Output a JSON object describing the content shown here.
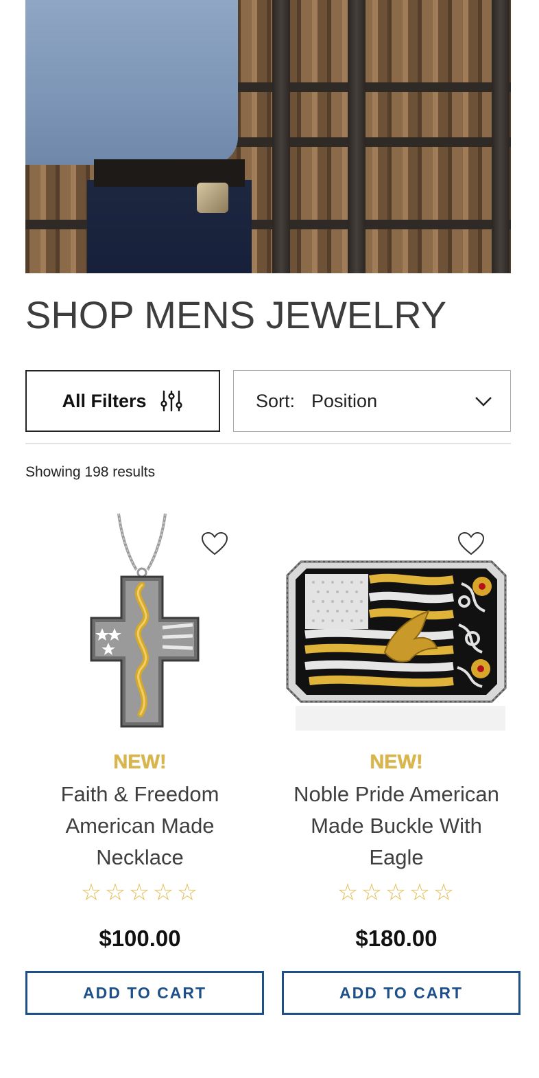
{
  "category": {
    "title": "SHOP MENS JEWELRY"
  },
  "toolbar": {
    "filters_label": "All Filters",
    "sort_label": "Sort:",
    "sort_value": "Position"
  },
  "results": {
    "count_text": "Showing 198 results"
  },
  "products": [
    {
      "badge": "NEW!",
      "name": "Faith & Freedom American Made Necklace",
      "rating_stars": 0,
      "max_stars": 5,
      "price": "$100.00",
      "cta": "ADD TO CART",
      "image_icon": "cross-necklace-image"
    },
    {
      "badge": "NEW!",
      "name": "Noble Pride American Made Buckle With Eagle",
      "rating_stars": 0,
      "max_stars": 5,
      "price": "$180.00",
      "cta": "ADD TO CART",
      "image_icon": "eagle-belt-buckle-image"
    }
  ],
  "colors": {
    "accent_blue": "#1d4f89",
    "badge_gold": "#d9b64a",
    "star_gold": "#e0bf55"
  }
}
